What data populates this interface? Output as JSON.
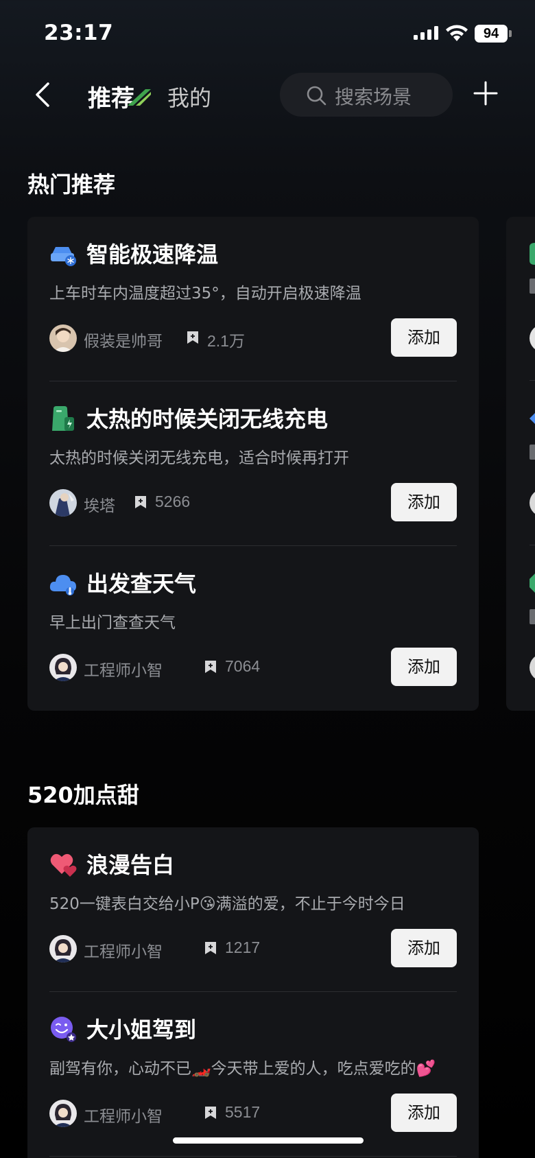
{
  "status": {
    "time": "23:17",
    "battery": "94"
  },
  "nav": {
    "tab_active": "推荐",
    "tab_inactive": "我的",
    "search_placeholder": "搜索场景"
  },
  "sections": [
    {
      "title": "热门推荐",
      "items": [
        {
          "icon": "car-snowflake-icon",
          "title": "智能极速降温",
          "desc": "上车时车内温度超过35°，自动开启极速降温",
          "author": "假装是帅哥",
          "count": "2.1万",
          "button": "添加"
        },
        {
          "icon": "phone-charging-icon",
          "title": "太热的时候关闭无线充电",
          "desc": "太热的时候关闭无线充电，适合时候再打开",
          "author": "埃塔",
          "count": "5266",
          "button": "添加"
        },
        {
          "icon": "cloud-weather-icon",
          "title": "出发查天气",
          "desc": "早上出门查查天气",
          "author": "工程师小智",
          "count": "7064",
          "button": "添加"
        }
      ]
    },
    {
      "title": "520加点甜",
      "items": [
        {
          "icon": "hearts-icon",
          "title": "浪漫告白",
          "desc": "520一键表白交给小P😘满溢的爱，不止于今时今日",
          "author": "工程师小智",
          "count": "1217",
          "button": "添加"
        },
        {
          "icon": "wink-face-icon",
          "title": "大小姐驾到",
          "desc": "副驾有你，心动不已🏎️今天带上爱的人，吃点爱吃的💕",
          "author": "工程师小智",
          "count": "5517",
          "button": "添加"
        }
      ]
    }
  ],
  "colors": {
    "card": "#141518",
    "button": "#f2f2f2",
    "muted": "#8c8e93"
  }
}
